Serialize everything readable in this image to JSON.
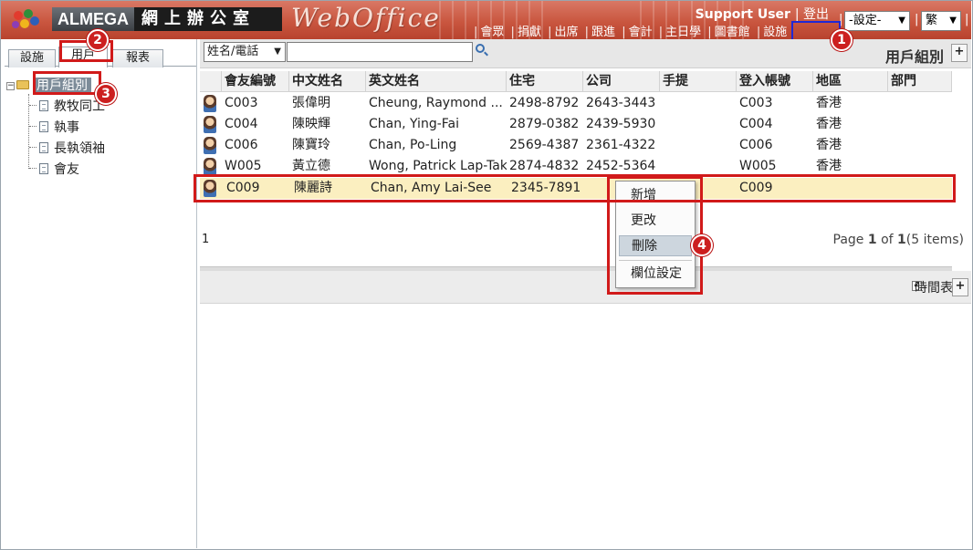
{
  "header": {
    "brand_en": "ALMEGA",
    "brand_zh": "網上辦公室",
    "brand_title": "WebOffice",
    "user": "Support User",
    "logout": "登出",
    "nav": [
      "會眾",
      "捐獻",
      "出席",
      "跟進",
      "會計",
      "主日學",
      "圖書館",
      "設施"
    ],
    "settings_select": "-設定-",
    "lang_select": "繁"
  },
  "left": {
    "tabs": [
      "設施",
      "用戶",
      "報表"
    ],
    "active_tab": "用戶",
    "tree_root": "用戶組別",
    "tree_children": [
      "教牧同工",
      "執事",
      "長執領袖",
      "會友"
    ]
  },
  "toolbar": {
    "filter_select": "姓名/電話",
    "search_value": "",
    "panel_title": "用戶組別",
    "add_label": "+"
  },
  "grid": {
    "columns": [
      "會友編號",
      "中文姓名",
      "英文姓名",
      "住宅",
      "公司",
      "手提",
      "登入帳號",
      "地區",
      "部門"
    ],
    "rows": [
      {
        "id": "C003",
        "zh": "張偉明",
        "en": "Cheung, Raymond ...",
        "home": "2498-8792",
        "office": "2643-3443",
        "mobile": "",
        "login": "C003",
        "region": "香港",
        "dept": ""
      },
      {
        "id": "C004",
        "zh": "陳映輝",
        "en": "Chan, Ying-Fai",
        "home": "2879-0382",
        "office": "2439-5930",
        "mobile": "",
        "login": "C004",
        "region": "香港",
        "dept": ""
      },
      {
        "id": "C006",
        "zh": "陳寶玲",
        "en": "Chan, Po-Ling",
        "home": "2569-4387",
        "office": "2361-4322",
        "mobile": "",
        "login": "C006",
        "region": "香港",
        "dept": ""
      },
      {
        "id": "W005",
        "zh": "黃立德",
        "en": "Wong, Patrick Lap-Tak",
        "home": "2874-4832",
        "office": "2452-5364",
        "mobile": "",
        "login": "W005",
        "region": "香港",
        "dept": ""
      },
      {
        "id": "C009",
        "zh": "陳麗詩",
        "en": "Chan, Amy Lai-See",
        "home": "2345-7891",
        "office": "",
        "mobile": "",
        "login": "C009",
        "region": "",
        "dept": ""
      }
    ],
    "pager_left": "1",
    "pager_page": "Page",
    "pager_num": "1",
    "pager_of": "of",
    "pager_total": "1",
    "pager_items": "(5 items)"
  },
  "context_menu": {
    "items": [
      "新增",
      "更改",
      "刪除",
      "欄位設定"
    ],
    "hover_item": "刪除"
  },
  "lower": {
    "schedule_label": "時間表",
    "schedule_checked": true,
    "add_label": "+"
  },
  "callouts": [
    "1",
    "2",
    "3",
    "4"
  ],
  "colors": {
    "header_red": "#c9563f",
    "selected_row": "#fbefc0",
    "callout_red": "#cc1f1f",
    "highlight_blue": "#1f28d6"
  }
}
